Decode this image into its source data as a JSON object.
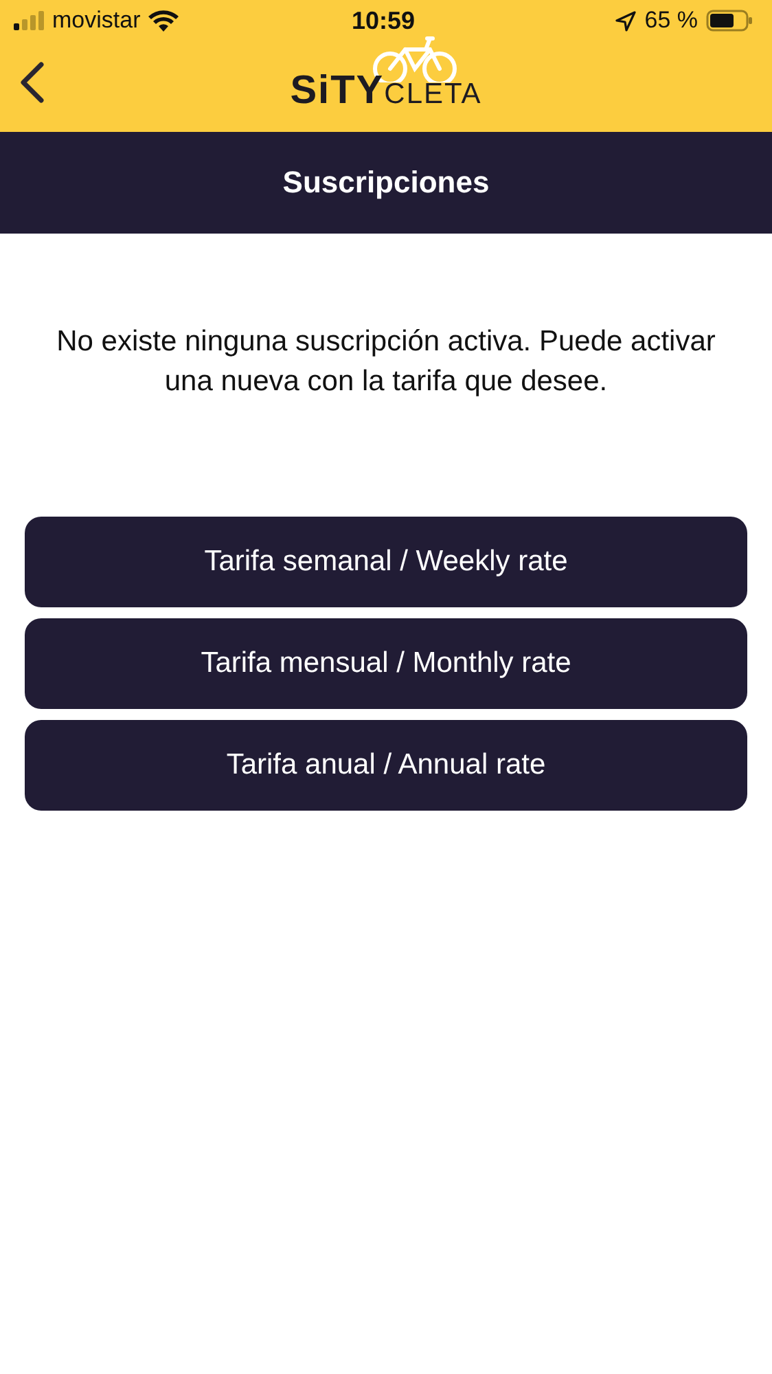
{
  "status_bar": {
    "carrier": "movistar",
    "time": "10:59",
    "battery": "65 %"
  },
  "header": {
    "logo": {
      "part_1": "SiTY",
      "part_2": "CLETA"
    }
  },
  "title": "Suscripciones",
  "message": "No existe ninguna suscripción activa. Puede activar una nueva con la tarifa que desee.",
  "buttons": [
    "Tarifa semanal / Weekly rate",
    "Tarifa mensual / Monthly rate",
    "Tarifa anual / Annual rate"
  ]
}
